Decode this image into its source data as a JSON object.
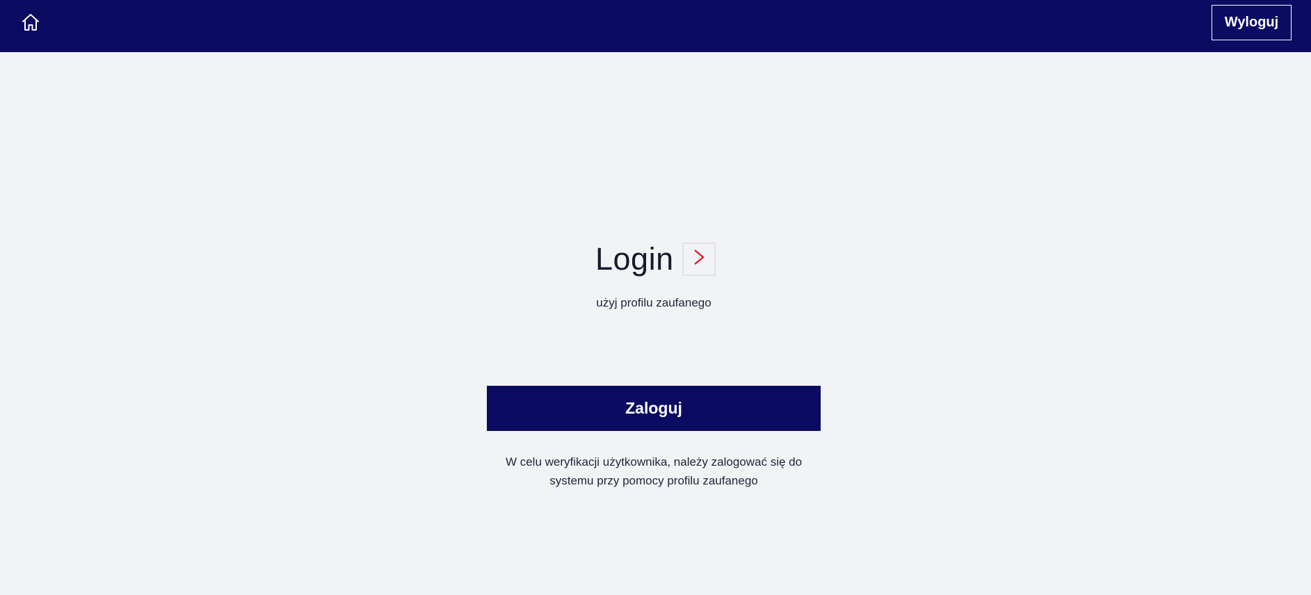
{
  "header": {
    "home_icon": "home-icon",
    "logout_label": "Wyloguj",
    "background_color": "#0b0b62"
  },
  "main": {
    "title": "Login",
    "chevron_icon": "chevron-right-icon",
    "chevron_color": "#e0141e",
    "subtitle": "użyj profilu zaufanego",
    "login_button_label": "Zaloguj",
    "info_line_1": "W celu weryfikacji użytkownika, należy zalogować się do",
    "info_line_2": "systemu przy pomocy profilu zaufanego"
  }
}
